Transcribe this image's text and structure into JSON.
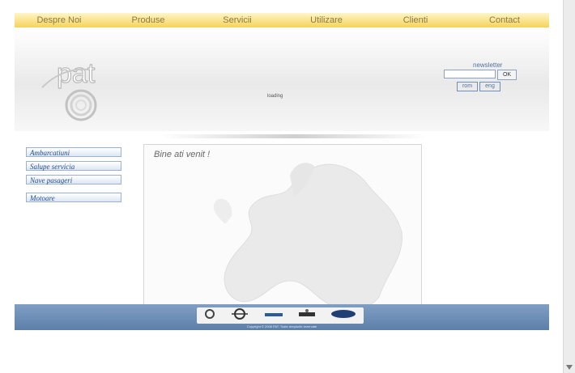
{
  "nav": [
    "Despre Noi",
    "Produse",
    "Servicii",
    "Utilizare",
    "Clienti",
    "Contact"
  ],
  "header": {
    "logo_text": "pat",
    "loading": "loading"
  },
  "newsletter": {
    "title": "newsletter",
    "input_value": "",
    "ok": "OK",
    "lang_rom": "rom",
    "lang_eng": "eng"
  },
  "menu": [
    "Ambarcatiuni",
    "Salupe servicia",
    "Nave pasageri",
    "Motoare"
  ],
  "content": {
    "welcome": "Bine ati venit !"
  },
  "footer": {
    "partners": [
      "logo-1",
      "logo-2",
      "logo-3",
      "logo-4",
      "logo-5"
    ],
    "copyright": "Copyright © 2008 PAT. Toate drepturile rezervate"
  },
  "colors": {
    "nav_yellow": "#f5d25a",
    "accent_blue": "#254e8f",
    "footer_blue": "#6a8ab3"
  }
}
